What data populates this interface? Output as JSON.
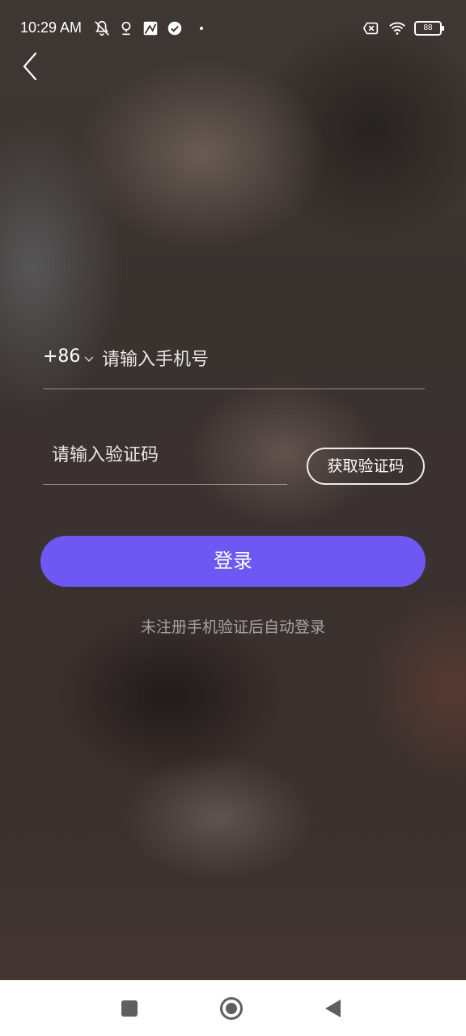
{
  "status_bar": {
    "time": "10:29 AM",
    "left_icons": [
      "silent-vibrate-icon",
      "location-pin-icon",
      "photo-app-icon",
      "check-circle-icon",
      "dot-icon"
    ],
    "right_icons": [
      "no-sim-icon",
      "wifi-icon"
    ],
    "battery_level": "88"
  },
  "header": {
    "back_icon": "chevron-left-icon"
  },
  "phone": {
    "country_code": "+86",
    "placeholder": "请输入手机号",
    "value": ""
  },
  "code": {
    "placeholder": "请输入验证码",
    "value": "",
    "get_code_label": "获取验证码"
  },
  "login": {
    "button_label": "登录",
    "hint": "未注册手机验证后自动登录"
  },
  "colors": {
    "accent": "#6e58f4",
    "text": "#ffffff",
    "nav_bar": "#ffffff"
  },
  "nav_bar": {
    "buttons": [
      "recent-apps-icon",
      "home-icon",
      "back-triangle-icon"
    ]
  }
}
